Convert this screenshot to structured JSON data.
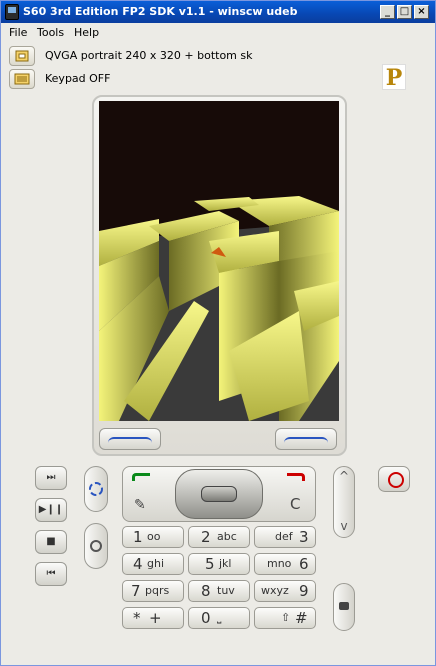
{
  "window": {
    "title": "S60 3rd Edition FP2 SDK v1.1 - winscw udeb",
    "minimize": "_",
    "maximize": "□",
    "close": "×"
  },
  "menu": {
    "file": "File",
    "tools": "Tools",
    "help": "Help"
  },
  "info": {
    "resolution": "QVGA portrait 240 x 320 + bottom sk",
    "keypad": "Keypad OFF"
  },
  "logo_letter": "P",
  "media": {
    "next": "⏭",
    "playpause": "▶❙❙",
    "stop": "■",
    "prev": "⏮"
  },
  "nav": {
    "clear": "C",
    "edit": "✎"
  },
  "volume": {
    "up": "^",
    "down": "v"
  },
  "keys": [
    {
      "l": "1",
      "s": "oo"
    },
    {
      "l": "2",
      "s": "abc"
    },
    {
      "l": "def",
      "s": "3"
    },
    {
      "l": "4",
      "s": "ghi"
    },
    {
      "l": "5",
      "s": "jkl"
    },
    {
      "l": "mno",
      "s": "6"
    },
    {
      "l": "7",
      "s": "pqrs"
    },
    {
      "l": "8",
      "s": "tuv"
    },
    {
      "l": "wxyz",
      "s": "9"
    },
    {
      "l": "*",
      "s": "+"
    },
    {
      "l": "0",
      "s": "⎵"
    },
    {
      "l": "⇧",
      "s": "#"
    }
  ],
  "colors": {
    "title_bar": "#0a5fd8",
    "screen_bg": "#170b08",
    "maze_wall": "#f2f27a",
    "maze_floor": "#3a3a3a",
    "call_green": "#0a8a1a",
    "end_red": "#cc0000"
  }
}
